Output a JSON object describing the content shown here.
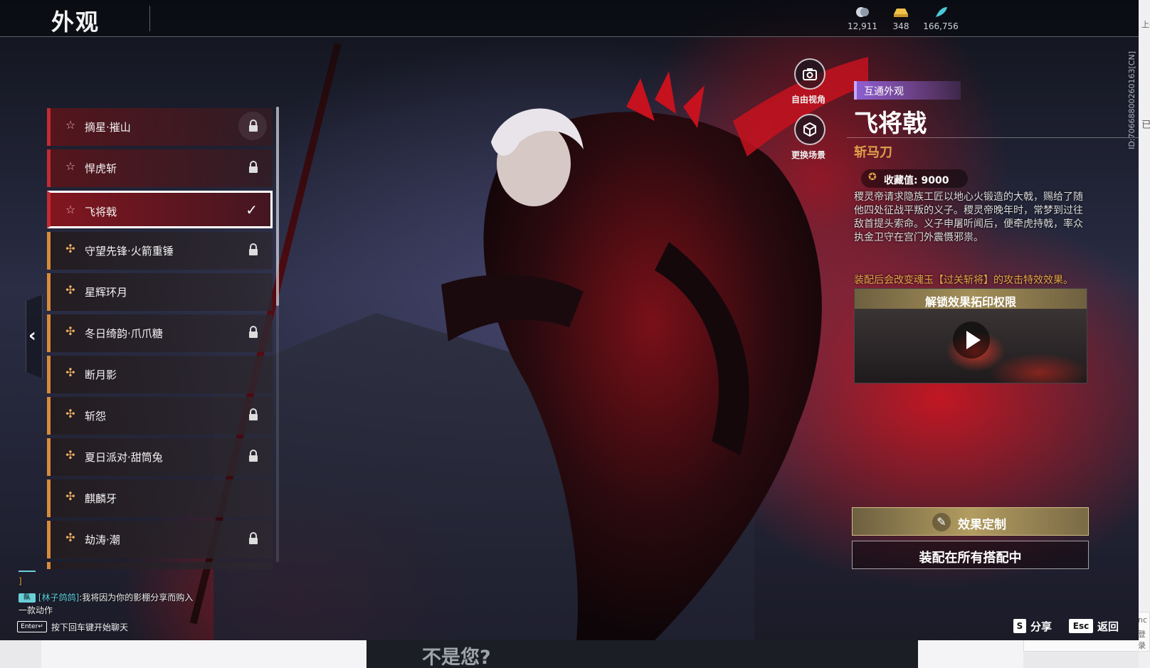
{
  "header": {
    "title": "外观",
    "currencies": [
      {
        "icon": "soul-coin-icon",
        "value": "12,911"
      },
      {
        "icon": "gold-ingot-icon",
        "value": "348"
      },
      {
        "icon": "feather-icon",
        "value": "166,756"
      }
    ]
  },
  "list": {
    "items": [
      {
        "label": "摘星·摧山",
        "rarity": "red",
        "state": "locked"
      },
      {
        "label": "悍虎斩",
        "rarity": "red",
        "state": "locked"
      },
      {
        "label": "飞将戟",
        "rarity": "red",
        "state": "selected"
      },
      {
        "label": "守望先锋·火箭重锤",
        "rarity": "orange",
        "state": "locked"
      },
      {
        "label": "星辉环月",
        "rarity": "orange",
        "state": "owned"
      },
      {
        "label": "冬日绮韵·爪爪糖",
        "rarity": "orange",
        "state": "locked"
      },
      {
        "label": "断月影",
        "rarity": "orange",
        "state": "owned"
      },
      {
        "label": "斩怨",
        "rarity": "orange",
        "state": "locked"
      },
      {
        "label": "夏日派对·甜筒兔",
        "rarity": "orange",
        "state": "locked"
      },
      {
        "label": "麒麟牙",
        "rarity": "orange",
        "state": "owned"
      },
      {
        "label": "劫涛·潮",
        "rarity": "orange",
        "state": "locked"
      }
    ]
  },
  "view_controls": {
    "free_camera": "自由视角",
    "change_scene": "更换场景"
  },
  "detail": {
    "tag": "互通外观",
    "name": "飞将戟",
    "subtype": "斩马刀",
    "collect_value": "收藏值: 9000",
    "description": "稷灵帝请求隐族工匠以地心火锻造的大戟，赐给了随他四处征战平叛的义子。稷灵帝晚年时，常梦到过往敌首提头索命。义子申屠听闻后，便牵虎持戟，率众执金卫守在宫门外震慑邪祟。",
    "effect_note": "装配后会改变魂玉【过关斩将】的攻击特效效果。",
    "unlock_title": "解锁效果拓印权限",
    "customize_button": "效果定制",
    "equip_all_button": "装配在所有搭配中"
  },
  "chat": {
    "line_1": "]",
    "badge": "队",
    "sender": "[林子鸽鸽]",
    "message_1": ":我将因为你的影棚分享而购入",
    "message_2": "一款动作",
    "enter_key": "Enter↵",
    "enter_hint": "按下回车键开始聊天"
  },
  "shortcuts": {
    "share_key": "S",
    "share_label": "分享",
    "back_key": "Esc",
    "back_label": "返回"
  },
  "browser": {
    "bottom_question": "不是您?",
    "side_id": "ID:70668800260163[CN]",
    "side_top": "上-",
    "side_mid": "已",
    "side_bottom_1": "nc",
    "side_bottom_2": "登录"
  },
  "colors": {
    "red_rarity": "#c32b33",
    "orange_rarity": "#d88a3a",
    "shared_tag": "#8b5fd0",
    "gold_text": "#e0a24a"
  }
}
